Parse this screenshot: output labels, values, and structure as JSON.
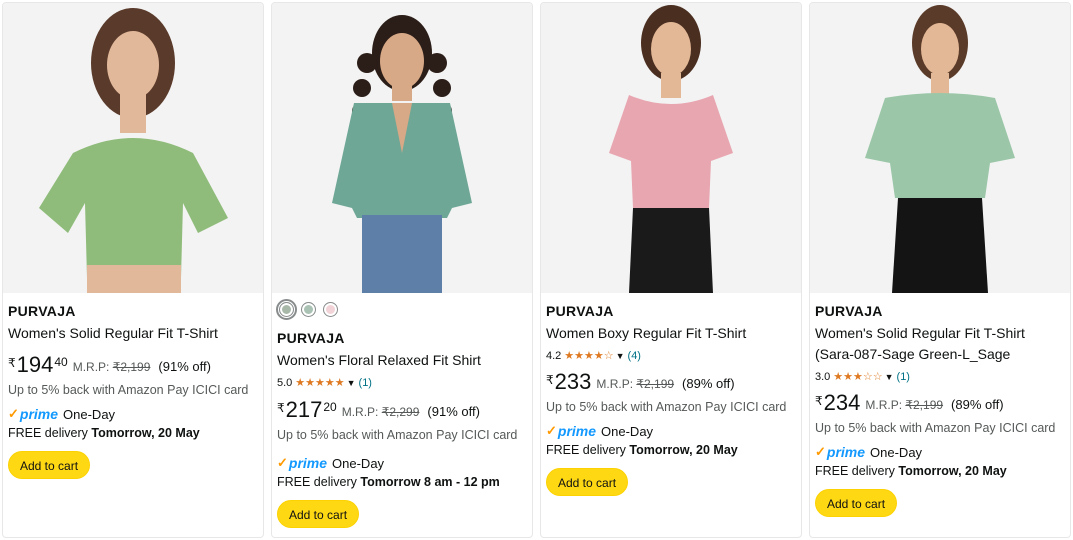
{
  "products": [
    {
      "brand": "PURVAJA",
      "title": "Women's Solid Regular Fit T-Shirt",
      "currency": "₹",
      "price_whole": "194",
      "price_fraction": "40",
      "mrp_label": "M.R.P:",
      "mrp_value": "₹2,199",
      "discount": "(91% off)",
      "cashback": "Up to 5% back with Amazon Pay ICICI card",
      "prime_label": "prime",
      "prime_speed": "One-Day",
      "delivery_prefix": "FREE delivery",
      "delivery_date": "Tomorrow, 20 May",
      "cart_label": "Add to cart",
      "top_color": "#8fbc7a",
      "pants_color": "#8fbc7a"
    },
    {
      "brand": "PURVAJA",
      "title": "Women's Floral Relaxed Fit Shirt",
      "swatch_colors": [
        "#a8b8a8",
        "#a9c2b4",
        "#f2d4d8"
      ],
      "rating_value": "5.0",
      "stars": "★★★★★",
      "rating_count": "(1)",
      "currency": "₹",
      "price_whole": "217",
      "price_fraction": "20",
      "mrp_label": "M.R.P:",
      "mrp_value": "₹2,299",
      "discount": "(91% off)",
      "cashback": "Up to 5% back with Amazon Pay ICICI card",
      "prime_label": "prime",
      "prime_speed": "One-Day",
      "delivery_prefix": "FREE delivery",
      "delivery_date": "Tomorrow 8 am - 12 pm",
      "cart_label": "Add to cart",
      "top_color": "#6fa796",
      "pants_color": "#5d7fa8"
    },
    {
      "brand": "PURVAJA",
      "title": "Women Boxy Regular Fit T-Shirt",
      "rating_value": "4.2",
      "stars": "★★★★☆",
      "rating_count": "(4)",
      "currency": "₹",
      "price_whole": "233",
      "mrp_label": "M.R.P:",
      "mrp_value": "₹2,199",
      "discount": "(89% off)",
      "cashback": "Up to 5% back with Amazon Pay ICICI card",
      "prime_label": "prime",
      "prime_speed": "One-Day",
      "delivery_prefix": "FREE delivery",
      "delivery_date": "Tomorrow, 20 May",
      "cart_label": "Add to cart",
      "top_color": "#e8a6b0",
      "pants_color": "#1a1a1a"
    },
    {
      "brand": "PURVAJA",
      "title": "Women's Solid Regular Fit T-Shirt (Sara-087-Sage Green-L_Sage",
      "rating_value": "3.0",
      "stars": "★★★☆☆",
      "rating_count": "(1)",
      "currency": "₹",
      "price_whole": "234",
      "mrp_label": "M.R.P:",
      "mrp_value": "₹2,199",
      "discount": "(89% off)",
      "cashback": "Up to 5% back with Amazon Pay ICICI card",
      "prime_label": "prime",
      "prime_speed": "One-Day",
      "delivery_prefix": "FREE delivery",
      "delivery_date": "Tomorrow, 20 May",
      "cart_label": "Add to cart",
      "top_color": "#9bc7a8",
      "pants_color": "#141414"
    }
  ]
}
